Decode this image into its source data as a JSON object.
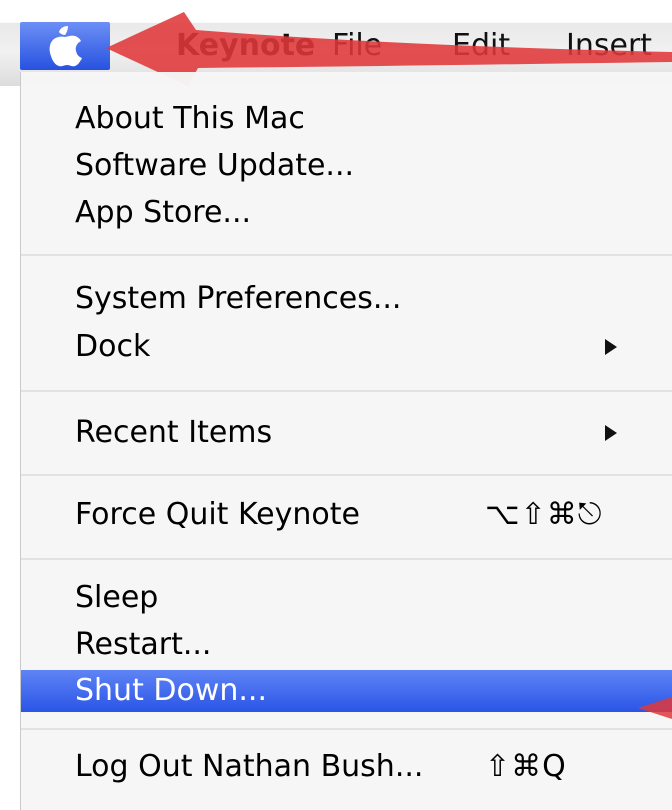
{
  "menubar": {
    "app_name": "Keynote",
    "items": [
      "File",
      "Edit",
      "Insert"
    ]
  },
  "apple_menu": {
    "items": [
      {
        "label": "About This Mac"
      },
      {
        "label": "Software Update..."
      },
      {
        "label": "App Store..."
      },
      {
        "label": "System Preferences..."
      },
      {
        "label": "Dock",
        "submenu": true
      },
      {
        "label": "Recent Items",
        "submenu": true
      },
      {
        "label": "Force Quit Keynote",
        "shortcut": "⌥⇧⌘⎋"
      },
      {
        "label": "Sleep"
      },
      {
        "label": "Restart..."
      },
      {
        "label": "Shut Down...",
        "highlighted": true
      },
      {
        "label": "Log Out Nathan Bush...",
        "shortcut": "⇧⌘Q"
      }
    ]
  },
  "colors": {
    "highlight": "#2a55e6",
    "annotation": "#e0383a",
    "menu_bg": "#f6f6f6"
  },
  "icons": {
    "apple": "apple-logo-icon",
    "submenu": "triangle-right-icon"
  }
}
